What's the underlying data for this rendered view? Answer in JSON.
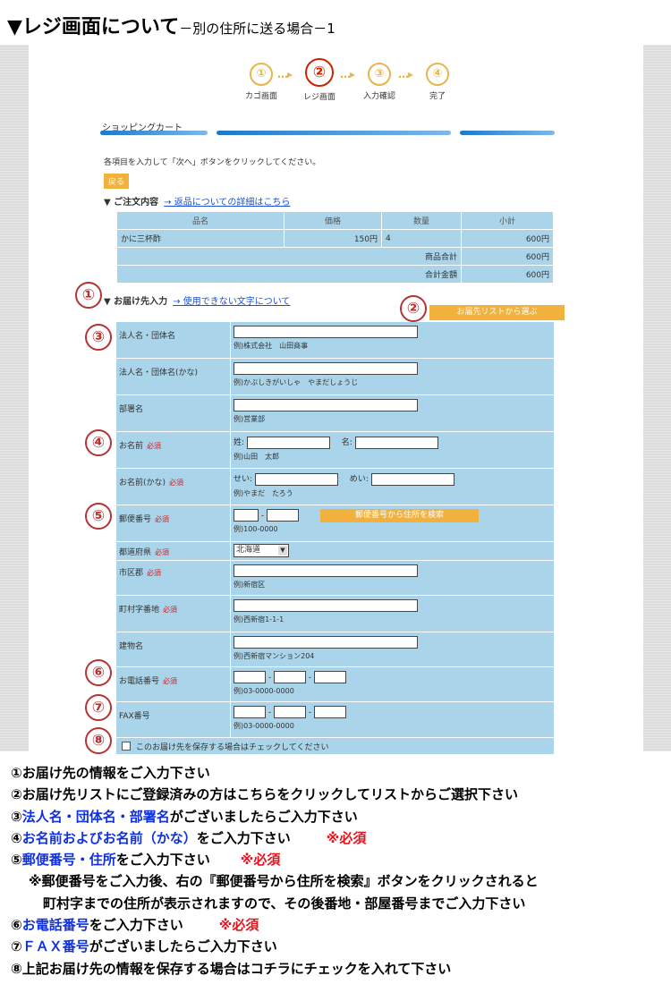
{
  "header": {
    "title": "▼レジ画面について",
    "subtitle": "－別の住所に送る場合－1"
  },
  "steps": [
    {
      "num": "①",
      "label": "カゴ画面"
    },
    {
      "num": "②",
      "label": "レジ画面"
    },
    {
      "num": "③",
      "label": "入力確認"
    },
    {
      "num": "④",
      "label": "完了"
    }
  ],
  "step_arrow": "…▸",
  "cart_title": "ショッピングカート",
  "instruction": "各項目を入力して「次へ」ボタンをクリックしてください。",
  "back_button": "戻る",
  "order_section": {
    "title": "▼ ご注文内容",
    "link": "→ 返品についての詳細はこちら"
  },
  "order_table": {
    "headers": [
      "品名",
      "価格",
      "数量",
      "小計"
    ],
    "rows": [
      {
        "name": "かに三杯酢",
        "price": "150円",
        "qty": "4",
        "subtotal": "600円"
      }
    ],
    "product_total_label": "商品合計",
    "product_total": "600円",
    "grand_total_label": "合計金額",
    "grand_total": "600円"
  },
  "delivery_section": {
    "title": "▼ お届け先入力",
    "link": "→ 使用できない文字について"
  },
  "address_list_button": "お届先リストから選ぶ",
  "markers": [
    "①",
    "②",
    "③",
    "④",
    "⑤",
    "⑥",
    "⑦",
    "⑧"
  ],
  "required_mark": "必須",
  "form": {
    "company": {
      "label": "法人名・団体名",
      "example": "例)株式会社　山田商事"
    },
    "company_kana": {
      "label": "法人名・団体名(かな)",
      "example": "例)かぶしきがいしゃ　やまだしょうじ"
    },
    "department": {
      "label": "部署名",
      "example": "例)営業部"
    },
    "name": {
      "label": "お名前",
      "sei": "姓:",
      "mei": "名:",
      "example": "例)山田　太郎"
    },
    "name_kana": {
      "label": "お名前(かな)",
      "sei": "せい:",
      "mei": "めい:",
      "example": "例)やまだ　たろう"
    },
    "zip": {
      "label": "郵便番号",
      "sep": "-",
      "button": "郵便番号から住所を検索",
      "example": "例)100-0000"
    },
    "prefecture": {
      "label": "都道府県",
      "value": "北海道"
    },
    "city": {
      "label": "市区郡",
      "example": "例)新宿区"
    },
    "street": {
      "label": "町村字番地",
      "example": "例)西新宿1-1-1"
    },
    "building": {
      "label": "建物名",
      "example": "例)西新宿マンション204"
    },
    "phone": {
      "label": "お電話番号",
      "sep": "-",
      "example": "例)03-0000-0000"
    },
    "fax": {
      "label": "FAX番号",
      "sep": "-",
      "example": "例)03-0000-0000"
    },
    "save": {
      "label": "このお届け先を保存する場合はチェックしてください"
    }
  },
  "notes": {
    "n1": "①お届け先の情報をご入力下さい",
    "n2": "②お届け先リストにご登録済みの方はこちらをクリックしてリストからご選択下さい",
    "n3_num": "③",
    "n3_blue": "法人名・団体名・部署名",
    "n3_rest": "がございましたらご入力下さい",
    "n4_num": "④",
    "n4_blue": "お名前およびお名前（かな）",
    "n4_rest": "をご入力下さい",
    "n4_req": "※必須",
    "n5_num": "⑤",
    "n5_blue": "郵便番号・住所",
    "n5_rest": "をご入力下さい",
    "n5_req": "※必須",
    "n5_sub1": "※郵便番号をご入力後、右の『郵便番号から住所を検索』ボタンをクリックされると",
    "n5_sub2": "町村字までの住所が表示されますので、その後番地・部屋番号までご入力下さい",
    "n6_num": "⑥",
    "n6_blue": "お電話番号",
    "n6_rest": "をご入力下さい",
    "n6_req": "※必須",
    "n7_num": "⑦",
    "n7_blue": "ＦＡＸ番号",
    "n7_rest": "がございましたらご入力下さい",
    "n8": "⑧上記お届け先の情報を保存する場合はコチラにチェックを入れて下さい"
  },
  "colors": {
    "table_bg": "#a9d4ea",
    "button_orange": "#f2b13c",
    "marker_red": "#b73232",
    "note_blue": "#1030e0",
    "note_red": "#e0141e"
  }
}
